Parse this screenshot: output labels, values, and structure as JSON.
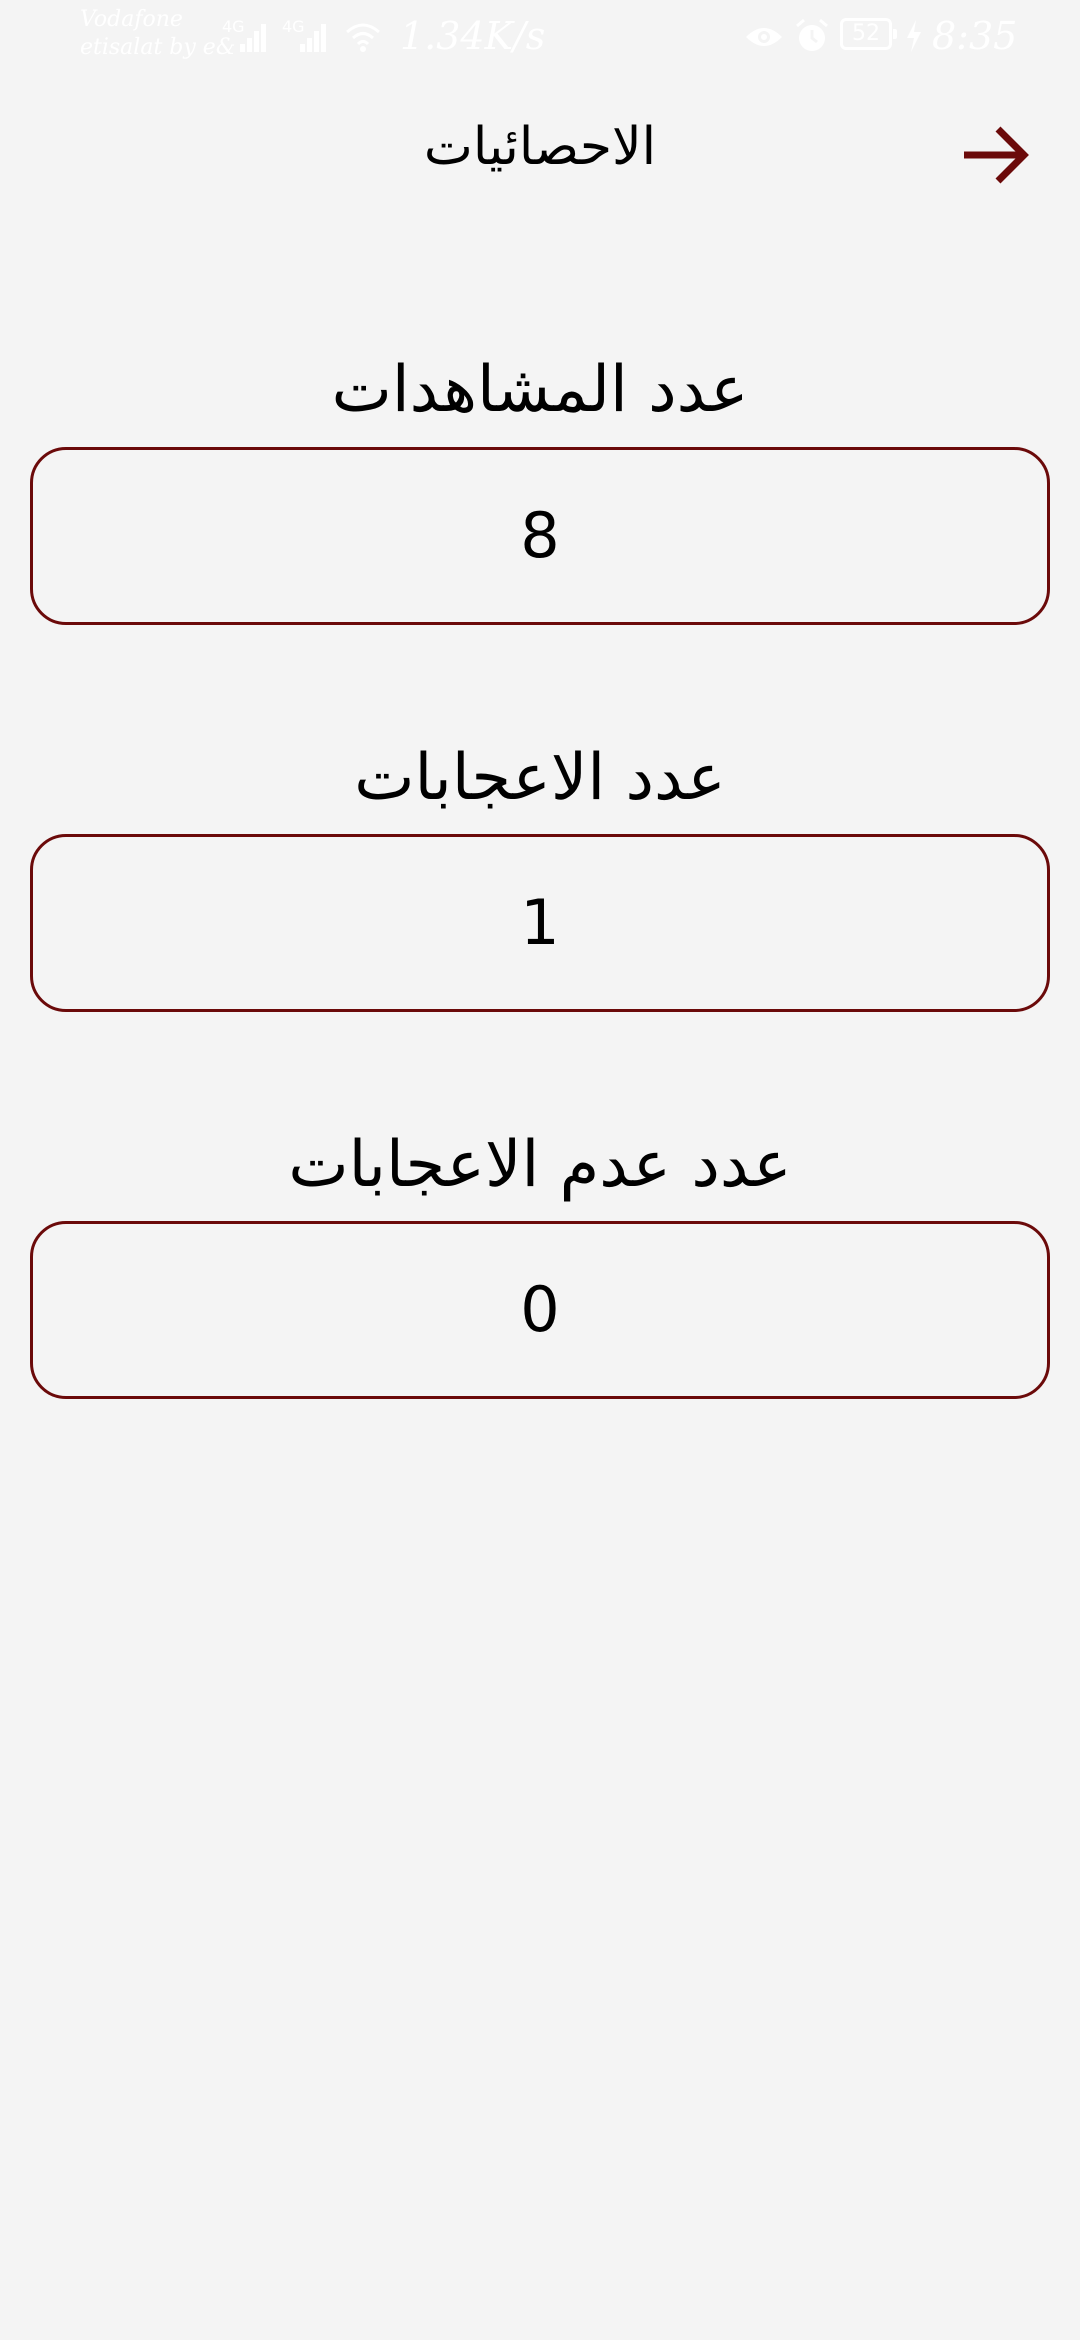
{
  "colors": {
    "accent": "#6b0a0a",
    "background": "#f4f4f4",
    "status_text": "#ffffff"
  },
  "status_bar": {
    "carrier_1": "Vodafone",
    "carrier_2": "etisalat by e&",
    "net_speed": "1.34K/s",
    "battery": "52",
    "time": "8:35",
    "icons": [
      "signal-icon",
      "signal-icon",
      "wifi-icon",
      "eye-icon",
      "alarm-icon",
      "battery-icon",
      "charging-icon"
    ]
  },
  "header": {
    "title": "الاحصائيات",
    "back_icon": "arrow-right-icon"
  },
  "stats": [
    {
      "label": "عدد المشاهدات",
      "value": "8"
    },
    {
      "label": "عدد الاعجابات",
      "value": "1"
    },
    {
      "label": "عدد عدم الاعجابات",
      "value": "0"
    }
  ]
}
